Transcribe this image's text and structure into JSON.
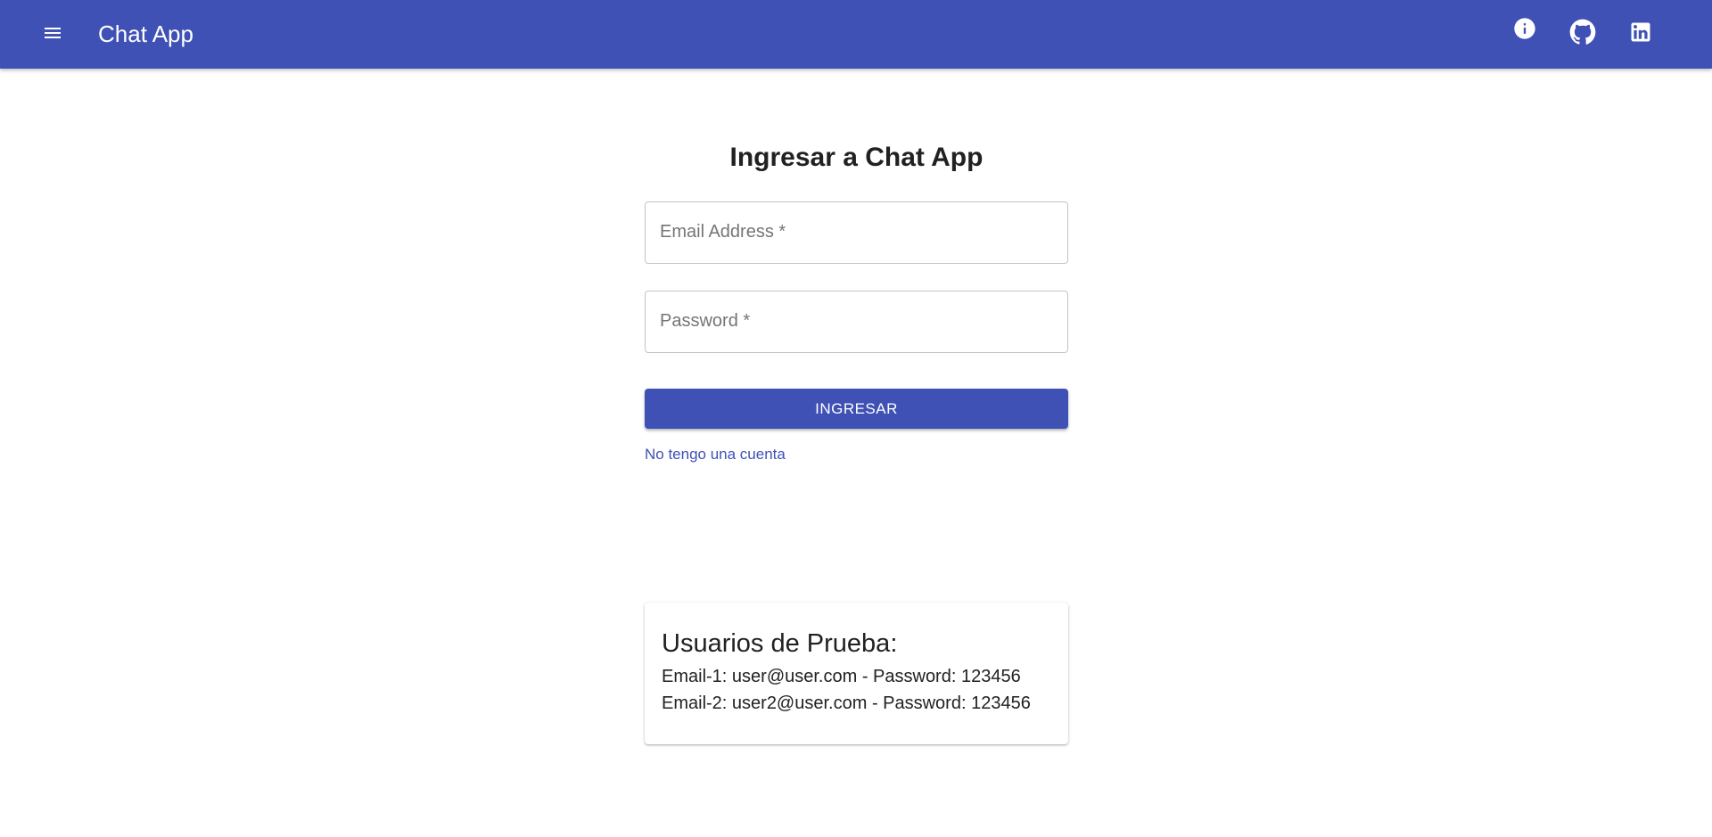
{
  "appbar": {
    "title": "Chat App",
    "color": "#3f51b5",
    "icons": [
      "menu-icon",
      "info-icon",
      "github-icon",
      "linkedin-icon"
    ]
  },
  "login": {
    "title": "Ingresar a Chat App",
    "email_label": "Email Address *",
    "password_label": "Password *",
    "submit_label": "INGRESAR",
    "register_link": "No tengo una cuenta"
  },
  "test_users": {
    "title": "Usuarios de Prueba:",
    "lines": [
      "Email-1: user@user.com - Password: 123456",
      "Email-2: user2@user.com - Password: 123456"
    ]
  }
}
